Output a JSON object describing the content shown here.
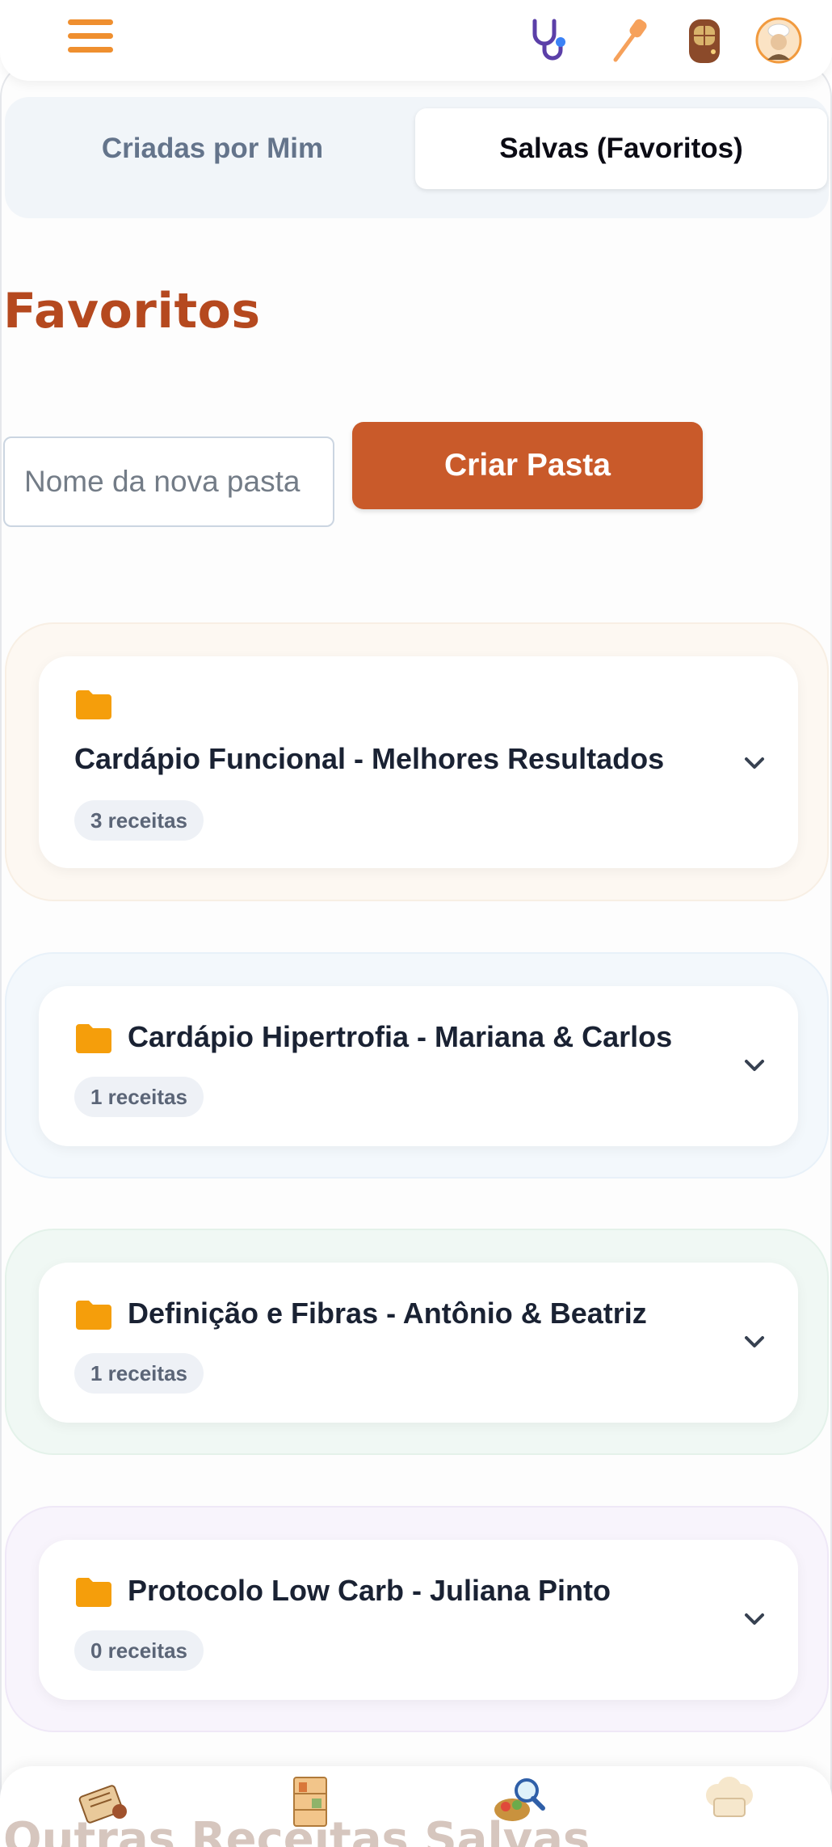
{
  "header": {
    "menu_icon": "hamburger-menu-icon",
    "icons": [
      "stethoscope-icon",
      "spatula-icon",
      "door-icon",
      "chef-avatar"
    ]
  },
  "tabs": [
    {
      "label": "Criadas por Mim",
      "active": false
    },
    {
      "label": "Salvas (Favoritos)",
      "active": true
    }
  ],
  "page": {
    "title": "Favoritos"
  },
  "create_folder": {
    "placeholder": "Nome da nova pasta",
    "button_label": "Criar Pasta"
  },
  "folders": [
    {
      "name": "Cardápio Funcional - Melhores Resultados",
      "count": "3 receitas",
      "tint": "#fdf6ee"
    },
    {
      "name": "Cardápio Hipertrofia - Mariana & Carlos",
      "count": "1 receitas",
      "tint": "#f1f7fc"
    },
    {
      "name": "Definição e Fibras - Antônio & Beatriz",
      "count": "1 receitas",
      "tint": "#eef7f3"
    },
    {
      "name": "Protocolo Low Carb - Juliana Pinto",
      "count": "0 receitas",
      "tint": "#f6f2fb"
    }
  ],
  "bottom": {
    "section_heading": "Outras Receitas Salvas",
    "nav_icons": [
      "recipe-book-icon",
      "pantry-icon",
      "search-recipes-icon",
      "chef-hat-icon"
    ]
  },
  "colors": {
    "accent": "#c95a2a",
    "title": "#b5491f",
    "folder_icon": "#f59e0b",
    "hamburger": "#ef8f2f"
  }
}
